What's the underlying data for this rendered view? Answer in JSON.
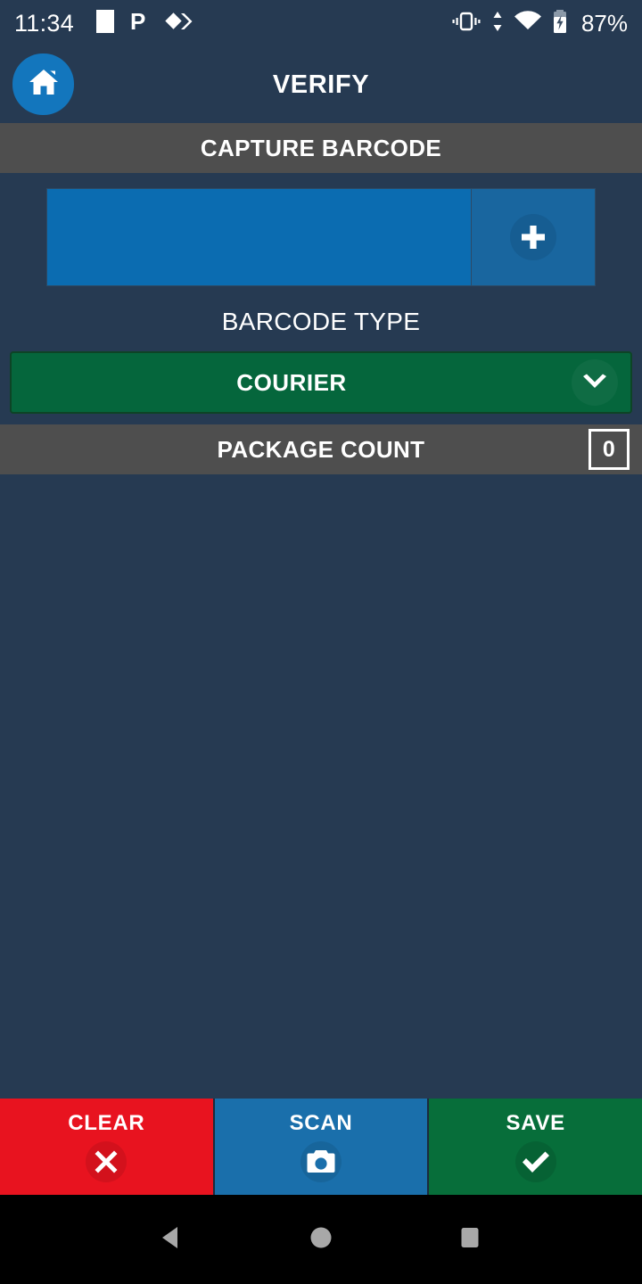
{
  "status_bar": {
    "time": "11:34",
    "battery_percent": "87%",
    "left_icons": [
      "white-square-icon",
      "pushbullet-p-icon",
      "diamond-chevron-icon"
    ],
    "right_icons": [
      "vibrate-icon",
      "data-transfer-icon",
      "wifi-icon",
      "battery-charging-icon"
    ]
  },
  "header": {
    "title": "VERIFY",
    "home_icon": "home-icon"
  },
  "sections": {
    "capture_barcode_label": "CAPTURE BARCODE",
    "barcode_type_label": "BARCODE TYPE",
    "package_count_label": "PACKAGE COUNT"
  },
  "barcode_input": {
    "value": "",
    "placeholder": "",
    "add_icon": "plus-icon"
  },
  "barcode_type": {
    "selected": "COURIER",
    "options": [
      "COURIER"
    ],
    "arrow_icon": "chevron-down-icon"
  },
  "package_count": {
    "value": "0"
  },
  "actions": [
    {
      "id": "clear",
      "label": "CLEAR",
      "icon": "close-x-icon",
      "color": "#e8131f"
    },
    {
      "id": "scan",
      "label": "SCAN",
      "icon": "camera-icon",
      "color": "#1a6fab"
    },
    {
      "id": "save",
      "label": "SAVE",
      "icon": "check-icon",
      "color": "#076e3a"
    }
  ],
  "nav_bar": {
    "back_icon": "back-triangle-icon",
    "home_icon": "home-circle-icon",
    "recents_icon": "recents-square-icon"
  },
  "theme": {
    "background": "#263a52",
    "gray_bar": "#4e4e4e",
    "accent_blue": "#1376bd",
    "input_blue": "#0b6cb1",
    "green": "#05663c"
  }
}
